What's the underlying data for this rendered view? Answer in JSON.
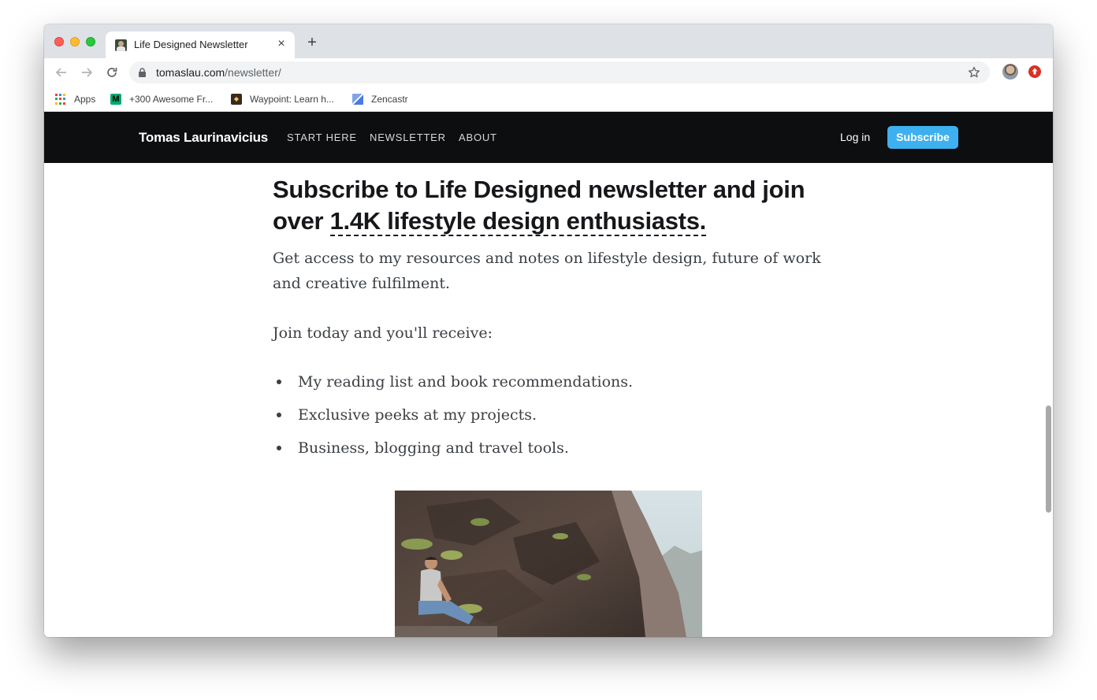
{
  "browser": {
    "tab_title": "Life Designed Newsletter",
    "tab_close": "×",
    "new_tab": "+",
    "url_host": "tomaslau.com",
    "url_path": "/newsletter/",
    "icons": [
      "back-arrow-icon",
      "forward-arrow-icon",
      "reload-icon",
      "lock-icon",
      "star-icon",
      "profile-avatar",
      "extension-icon"
    ],
    "bookmarks": [
      {
        "label": "Apps",
        "icon": "apps-grid-icon"
      },
      {
        "label": "+300 Awesome Fr...",
        "icon": "medium-icon"
      },
      {
        "label": "Waypoint: Learn h...",
        "icon": "waypoint-icon"
      },
      {
        "label": "Zencastr",
        "icon": "zencastr-icon"
      }
    ]
  },
  "site": {
    "brand": "Tomas Laurinavicius",
    "nav": [
      "START HERE",
      "NEWSLETTER",
      "ABOUT"
    ],
    "login": "Log in",
    "subscribe": "Subscribe",
    "header_bg": "#0d0e0f",
    "accent": "#3eb0ef"
  },
  "content": {
    "headline_lead": "Subscribe to Life Designed newsletter and join over ",
    "headline_highlight": "1.4K lifestyle design enthusiasts.",
    "lede": "Get access to my resources and notes on lifestyle design, future of work and creative fulfilment.",
    "intro": "Join today and you'll receive:",
    "benefits": [
      "My reading list and book recommendations.",
      "Exclusive peeks at my projects.",
      "Business, blogging and travel tools."
    ]
  }
}
